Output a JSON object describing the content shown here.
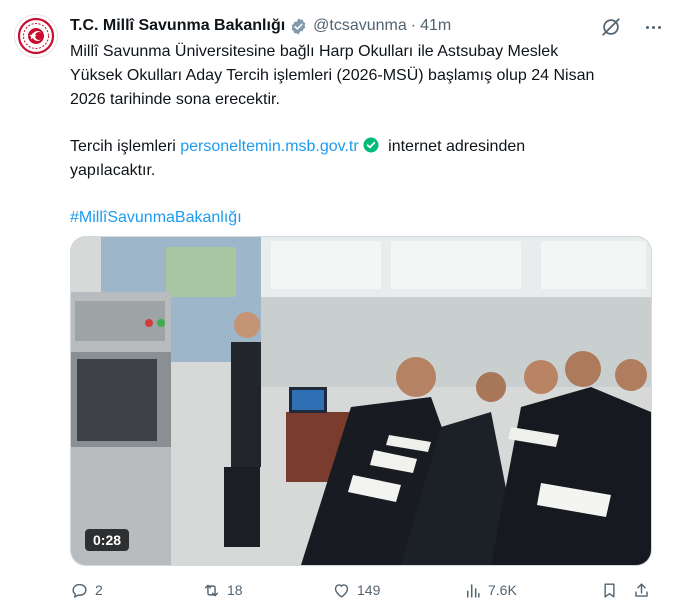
{
  "tweet": {
    "author_name": "T.C. Millî Savunma Bakanlığı",
    "handle": "@tcsavunma",
    "separator": "·",
    "time": "41m",
    "line1": "Millî Savunma Üniversitesine bağlı Harp Okulları ile Astsubay Meslek",
    "line2": "Yüksek Okulları Aday Tercih işlemleri (2026-MSÜ) başlamış olup 24 Nisan",
    "line3": "2026 tarihinde sona erecektir.",
    "line4_prefix": "Tercih işlemleri",
    "link_text": "personeltemin.msb.gov.tr",
    "line4_suffix": "internet adresinden",
    "line5": "yapılacaktır.",
    "hashtag": "#MillîSavunmaBakanlığı"
  },
  "media": {
    "duration": "0:28"
  },
  "actions": {
    "replies": "2",
    "reposts": "18",
    "likes": "149",
    "views": "7.6K"
  },
  "colors": {
    "link": "#1d9bf0",
    "verified_gray": "#829aab",
    "check_green": "#00ba7c",
    "text_secondary": "#536471",
    "brand_red": "#c8102e"
  },
  "icons": [
    "verified-badge-icon",
    "grok-icon",
    "more-icon",
    "link-verified-icon",
    "reply-icon",
    "repost-icon",
    "like-icon",
    "views-icon",
    "bookmark-icon",
    "share-icon"
  ]
}
